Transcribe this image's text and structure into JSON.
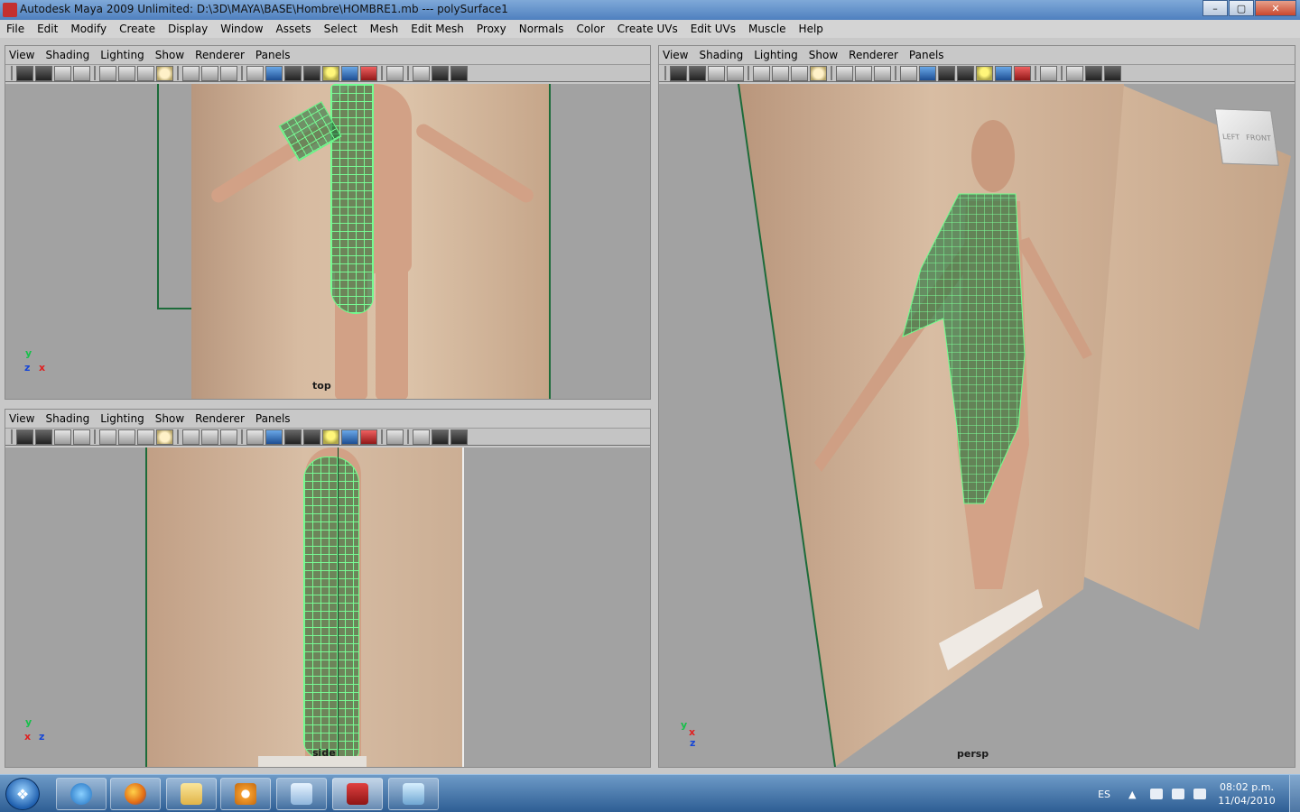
{
  "window": {
    "title": "Autodesk Maya 2009 Unlimited: D:\\3D\\MAYA\\BASE\\Hombre\\HOMBRE1.mb  ---  polySurface1",
    "controls": [
      "–",
      "▢",
      "✕"
    ]
  },
  "menubar": [
    "File",
    "Edit",
    "Modify",
    "Create",
    "Display",
    "Window",
    "Assets",
    "Select",
    "Mesh",
    "Edit Mesh",
    "Proxy",
    "Normals",
    "Color",
    "Create UVs",
    "Edit UVs",
    "Muscle",
    "Help"
  ],
  "panels": {
    "menu": [
      "View",
      "Shading",
      "Lighting",
      "Show",
      "Renderer",
      "Panels"
    ],
    "top": {
      "label": "top",
      "axes": {
        "y": "y",
        "z": "z",
        "x": "x"
      }
    },
    "side": {
      "label": "side",
      "axes": {
        "y": "y",
        "x": "x",
        "z": "z"
      }
    },
    "persp": {
      "label": "persp",
      "axes": {
        "y": "y",
        "x": "x",
        "z": "z"
      },
      "viewcube": {
        "left": "LEFT",
        "front": "FRONT"
      }
    }
  },
  "taskbar": {
    "language": "ES",
    "time": "08:02 p.m.",
    "date": "11/04/2010"
  }
}
